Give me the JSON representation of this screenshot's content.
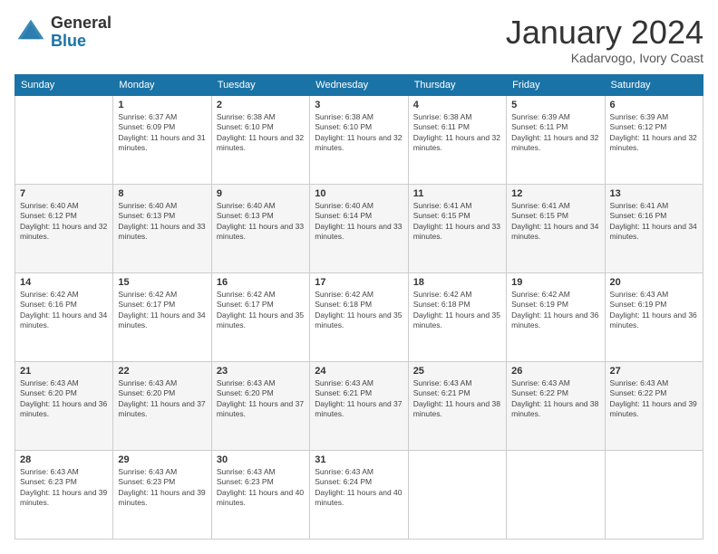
{
  "logo": {
    "general": "General",
    "blue": "Blue"
  },
  "title": {
    "month": "January 2024",
    "location": "Kadarvogo, Ivory Coast"
  },
  "weekdays": [
    "Sunday",
    "Monday",
    "Tuesday",
    "Wednesday",
    "Thursday",
    "Friday",
    "Saturday"
  ],
  "weeks": [
    [
      {
        "day": "",
        "sunrise": "",
        "sunset": "",
        "daylight": ""
      },
      {
        "day": "1",
        "sunrise": "Sunrise: 6:37 AM",
        "sunset": "Sunset: 6:09 PM",
        "daylight": "Daylight: 11 hours and 31 minutes."
      },
      {
        "day": "2",
        "sunrise": "Sunrise: 6:38 AM",
        "sunset": "Sunset: 6:10 PM",
        "daylight": "Daylight: 11 hours and 32 minutes."
      },
      {
        "day": "3",
        "sunrise": "Sunrise: 6:38 AM",
        "sunset": "Sunset: 6:10 PM",
        "daylight": "Daylight: 11 hours and 32 minutes."
      },
      {
        "day": "4",
        "sunrise": "Sunrise: 6:38 AM",
        "sunset": "Sunset: 6:11 PM",
        "daylight": "Daylight: 11 hours and 32 minutes."
      },
      {
        "day": "5",
        "sunrise": "Sunrise: 6:39 AM",
        "sunset": "Sunset: 6:11 PM",
        "daylight": "Daylight: 11 hours and 32 minutes."
      },
      {
        "day": "6",
        "sunrise": "Sunrise: 6:39 AM",
        "sunset": "Sunset: 6:12 PM",
        "daylight": "Daylight: 11 hours and 32 minutes."
      }
    ],
    [
      {
        "day": "7",
        "sunrise": "Sunrise: 6:40 AM",
        "sunset": "Sunset: 6:12 PM",
        "daylight": "Daylight: 11 hours and 32 minutes."
      },
      {
        "day": "8",
        "sunrise": "Sunrise: 6:40 AM",
        "sunset": "Sunset: 6:13 PM",
        "daylight": "Daylight: 11 hours and 33 minutes."
      },
      {
        "day": "9",
        "sunrise": "Sunrise: 6:40 AM",
        "sunset": "Sunset: 6:13 PM",
        "daylight": "Daylight: 11 hours and 33 minutes."
      },
      {
        "day": "10",
        "sunrise": "Sunrise: 6:40 AM",
        "sunset": "Sunset: 6:14 PM",
        "daylight": "Daylight: 11 hours and 33 minutes."
      },
      {
        "day": "11",
        "sunrise": "Sunrise: 6:41 AM",
        "sunset": "Sunset: 6:15 PM",
        "daylight": "Daylight: 11 hours and 33 minutes."
      },
      {
        "day": "12",
        "sunrise": "Sunrise: 6:41 AM",
        "sunset": "Sunset: 6:15 PM",
        "daylight": "Daylight: 11 hours and 34 minutes."
      },
      {
        "day": "13",
        "sunrise": "Sunrise: 6:41 AM",
        "sunset": "Sunset: 6:16 PM",
        "daylight": "Daylight: 11 hours and 34 minutes."
      }
    ],
    [
      {
        "day": "14",
        "sunrise": "Sunrise: 6:42 AM",
        "sunset": "Sunset: 6:16 PM",
        "daylight": "Daylight: 11 hours and 34 minutes."
      },
      {
        "day": "15",
        "sunrise": "Sunrise: 6:42 AM",
        "sunset": "Sunset: 6:17 PM",
        "daylight": "Daylight: 11 hours and 34 minutes."
      },
      {
        "day": "16",
        "sunrise": "Sunrise: 6:42 AM",
        "sunset": "Sunset: 6:17 PM",
        "daylight": "Daylight: 11 hours and 35 minutes."
      },
      {
        "day": "17",
        "sunrise": "Sunrise: 6:42 AM",
        "sunset": "Sunset: 6:18 PM",
        "daylight": "Daylight: 11 hours and 35 minutes."
      },
      {
        "day": "18",
        "sunrise": "Sunrise: 6:42 AM",
        "sunset": "Sunset: 6:18 PM",
        "daylight": "Daylight: 11 hours and 35 minutes."
      },
      {
        "day": "19",
        "sunrise": "Sunrise: 6:42 AM",
        "sunset": "Sunset: 6:19 PM",
        "daylight": "Daylight: 11 hours and 36 minutes."
      },
      {
        "day": "20",
        "sunrise": "Sunrise: 6:43 AM",
        "sunset": "Sunset: 6:19 PM",
        "daylight": "Daylight: 11 hours and 36 minutes."
      }
    ],
    [
      {
        "day": "21",
        "sunrise": "Sunrise: 6:43 AM",
        "sunset": "Sunset: 6:20 PM",
        "daylight": "Daylight: 11 hours and 36 minutes."
      },
      {
        "day": "22",
        "sunrise": "Sunrise: 6:43 AM",
        "sunset": "Sunset: 6:20 PM",
        "daylight": "Daylight: 11 hours and 37 minutes."
      },
      {
        "day": "23",
        "sunrise": "Sunrise: 6:43 AM",
        "sunset": "Sunset: 6:20 PM",
        "daylight": "Daylight: 11 hours and 37 minutes."
      },
      {
        "day": "24",
        "sunrise": "Sunrise: 6:43 AM",
        "sunset": "Sunset: 6:21 PM",
        "daylight": "Daylight: 11 hours and 37 minutes."
      },
      {
        "day": "25",
        "sunrise": "Sunrise: 6:43 AM",
        "sunset": "Sunset: 6:21 PM",
        "daylight": "Daylight: 11 hours and 38 minutes."
      },
      {
        "day": "26",
        "sunrise": "Sunrise: 6:43 AM",
        "sunset": "Sunset: 6:22 PM",
        "daylight": "Daylight: 11 hours and 38 minutes."
      },
      {
        "day": "27",
        "sunrise": "Sunrise: 6:43 AM",
        "sunset": "Sunset: 6:22 PM",
        "daylight": "Daylight: 11 hours and 39 minutes."
      }
    ],
    [
      {
        "day": "28",
        "sunrise": "Sunrise: 6:43 AM",
        "sunset": "Sunset: 6:23 PM",
        "daylight": "Daylight: 11 hours and 39 minutes."
      },
      {
        "day": "29",
        "sunrise": "Sunrise: 6:43 AM",
        "sunset": "Sunset: 6:23 PM",
        "daylight": "Daylight: 11 hours and 39 minutes."
      },
      {
        "day": "30",
        "sunrise": "Sunrise: 6:43 AM",
        "sunset": "Sunset: 6:23 PM",
        "daylight": "Daylight: 11 hours and 40 minutes."
      },
      {
        "day": "31",
        "sunrise": "Sunrise: 6:43 AM",
        "sunset": "Sunset: 6:24 PM",
        "daylight": "Daylight: 11 hours and 40 minutes."
      },
      {
        "day": "",
        "sunrise": "",
        "sunset": "",
        "daylight": ""
      },
      {
        "day": "",
        "sunrise": "",
        "sunset": "",
        "daylight": ""
      },
      {
        "day": "",
        "sunrise": "",
        "sunset": "",
        "daylight": ""
      }
    ]
  ]
}
